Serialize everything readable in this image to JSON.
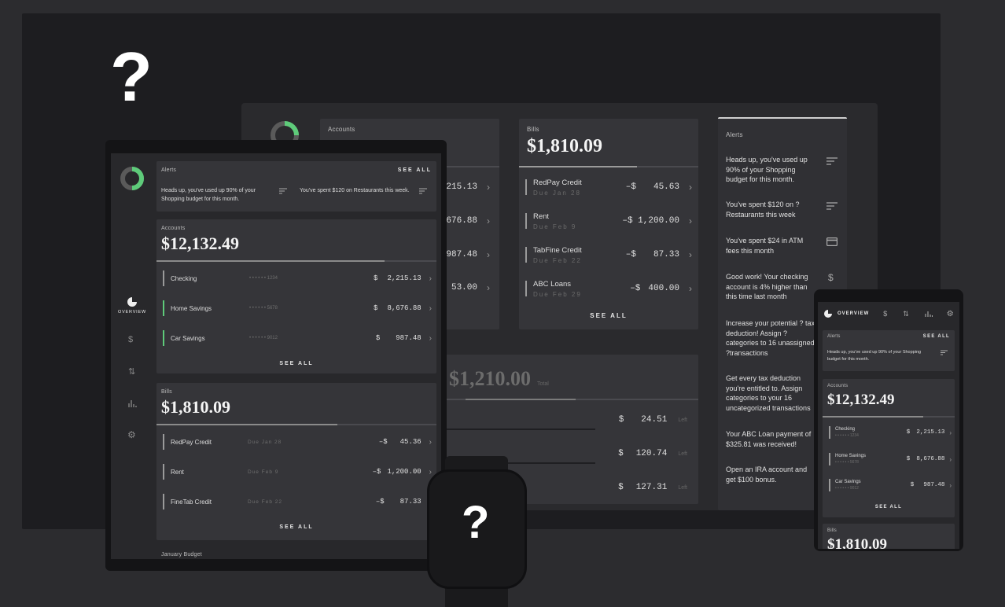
{
  "question_mark": "?",
  "desktop": {
    "accounts_label": "Accounts",
    "accounts_values": [
      "215.13",
      "676.88",
      "987.48",
      "53.00"
    ],
    "bills": {
      "label": "Bills",
      "total": "$1,810.09",
      "items": [
        {
          "name": "RedPay Credit",
          "due": "Due Jan 28",
          "sign": "–$",
          "amount": "45.63"
        },
        {
          "name": "Rent",
          "due": "Due Feb 9",
          "sign": "–$ 1,200.00",
          "amount": ""
        },
        {
          "name": "TabFine Credit",
          "due": "Due Feb 22",
          "sign": "–$",
          "amount": "87.33"
        },
        {
          "name": "ABC Loans",
          "due": "Due Feb 29",
          "sign": "–$",
          "amount": "400.00"
        }
      ],
      "see_all": "SEE ALL"
    },
    "budget": {
      "total": "$1,210.00",
      "total_suffix": "Total",
      "items": [
        {
          "sign": "$",
          "amount": "24.51",
          "suffix": "Left"
        },
        {
          "sign": "$",
          "amount": "120.74",
          "suffix": "Left"
        },
        {
          "sign": "$",
          "amount": "127.31",
          "suffix": "Left"
        }
      ]
    },
    "alerts": {
      "title": "Alerts",
      "items": [
        "Heads up, you've used up 90% of your Shopping budget for this month.",
        "You've spent $120 on ? Restaurants this week",
        "You've spent $24 in ATM fees this month",
        "Good work! Your checking account is 4% higher than this time last month",
        "Increase your potential ? tax deduction! Assign ? categories to 16 unassigned ?transactions",
        "Get every tax deduction you're entitled to. Assign categories to your 16 uncategorized transactions",
        "Your ABC Loan payment of $325.81 was received!",
        "Open an IRA account and get $100 bonus."
      ]
    }
  },
  "tablet": {
    "alerts": {
      "title": "Alerts",
      "see_all": "SEE ALL",
      "items": [
        "Heads up, you've used up 90% of your Shopping budget for this month.",
        "You've spent $120 on Restaurants this week."
      ]
    },
    "accounts": {
      "label": "Accounts",
      "total": "$12,132.49",
      "items": [
        {
          "name": "Checking",
          "mask": "• • • • • • 1234",
          "sign": "$",
          "amount": "2,215.13"
        },
        {
          "name": "Home Savings",
          "mask": "• • • • • • 5678",
          "sign": "$",
          "amount": "8,676.88"
        },
        {
          "name": "Car Savings",
          "mask": "• • • • • • 9012",
          "sign": "$",
          "amount": "987.48"
        }
      ],
      "see_all": "SEE ALL"
    },
    "bills": {
      "label": "Bills",
      "total": "$1,810.09",
      "items": [
        {
          "name": "RedPay Credit",
          "due": "Due Jan 28",
          "sign": "–$",
          "amount": "45.36"
        },
        {
          "name": "Rent",
          "due": "Due Feb 9",
          "sign": "–$",
          "amount": "1,200.00"
        },
        {
          "name": "FineTab Credit",
          "due": "Due Feb 22",
          "sign": "–$",
          "amount": "87.33"
        }
      ],
      "see_all": "SEE ALL"
    },
    "budget_label": "January Budget",
    "nav": {
      "overview": "OVERVIEW"
    }
  },
  "phone": {
    "nav": {
      "overview": "OVERVIEW"
    },
    "alerts": {
      "title": "Alerts",
      "see_all": "SEE ALL",
      "item": "Heads up, you've used up 90% of your Shopping budget for this month."
    },
    "accounts": {
      "label": "Accounts",
      "total": "$12,132.49",
      "items": [
        {
          "name": "Checking",
          "mask": "• • • • • • 1234",
          "sign": "$",
          "amount": "2,215.13"
        },
        {
          "name": "Home Savings",
          "mask": "• • • • • • 5678",
          "sign": "$",
          "amount": "8,676.88"
        },
        {
          "name": "Car Savings",
          "mask": "• • • • • • 9012",
          "sign": "$",
          "amount": "987.48"
        }
      ],
      "see_all": "SEE ALL"
    },
    "bills_label": "Bills",
    "bills_total": "$1,810.09"
  },
  "colors": {
    "accent": "#5ecb7a",
    "background": "#2c2c2f",
    "panel": "#353539"
  }
}
